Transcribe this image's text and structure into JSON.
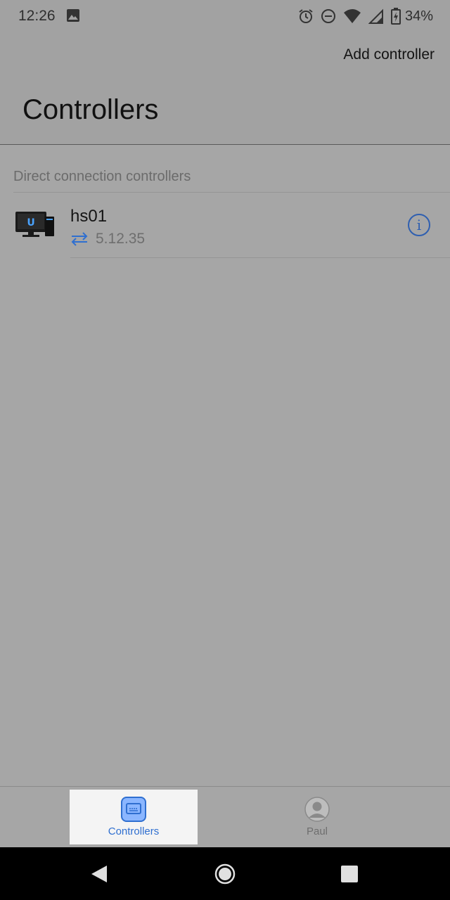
{
  "status_bar": {
    "time": "12:26",
    "battery_percent": "34%"
  },
  "header": {
    "action_label": "Add controller",
    "title": "Controllers"
  },
  "section": {
    "title": "Direct connection controllers"
  },
  "controllers": [
    {
      "name": "hs01",
      "version": "5.12.35"
    }
  ],
  "bottom_nav": {
    "tabs": [
      {
        "label": "Controllers",
        "active": true
      },
      {
        "label": "Paul",
        "active": false
      }
    ]
  },
  "colors": {
    "accent": "#2f6fd0",
    "background": "#a6a6a6"
  }
}
